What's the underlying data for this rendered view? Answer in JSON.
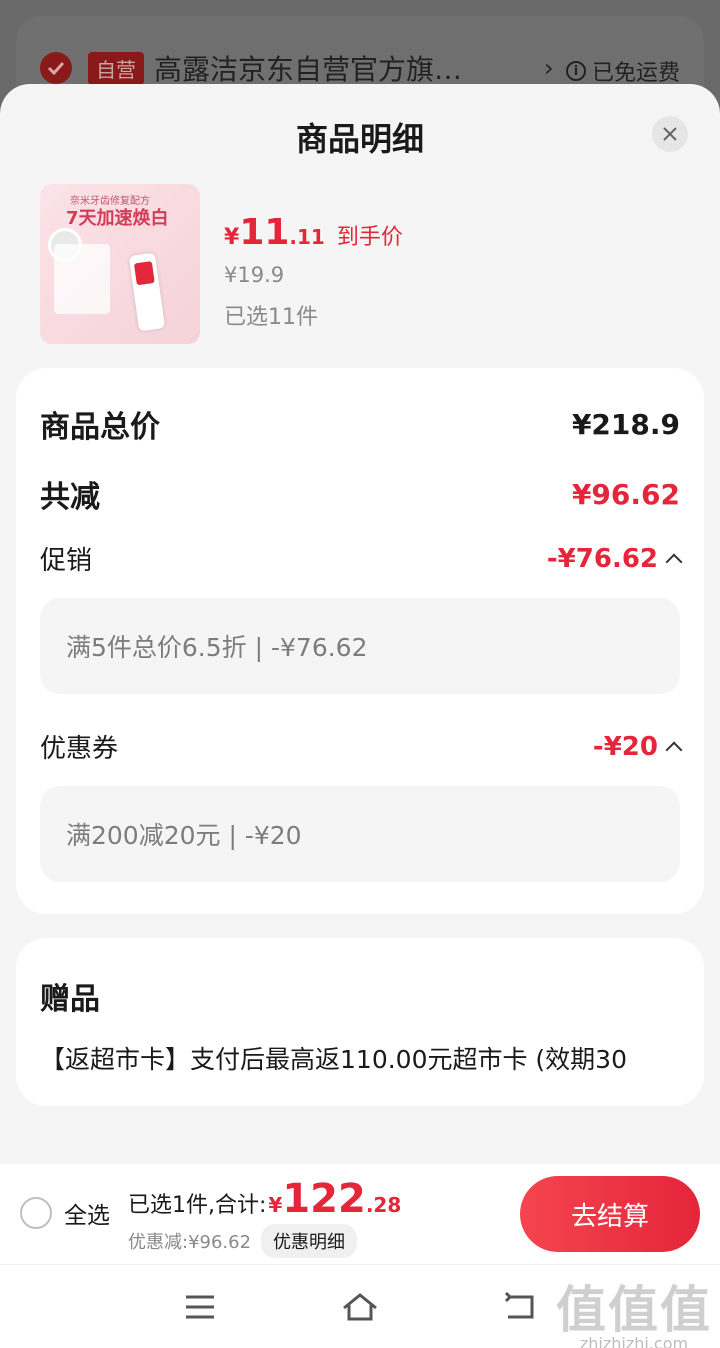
{
  "store_header": {
    "tag": "自营",
    "store_name": "高露洁京东自营官方旗…",
    "shipping": "已免运费"
  },
  "sheet": {
    "title": "商品明细"
  },
  "product": {
    "image_caption_small": "奈米牙齿修复配方",
    "image_caption_big": "7天加速焕白",
    "price_symbol": "¥",
    "price_int": "11",
    "price_dec": ".11",
    "price_tag": "到手价",
    "original_price": "¥19.9",
    "selected_qty": "已选11件"
  },
  "summary": {
    "total_label": "商品总价",
    "total_value": "¥218.9",
    "reduce_label": "共减",
    "reduce_value": "¥96.62",
    "promo_label": "促销",
    "promo_value": "-¥76.62",
    "promo_detail": "满5件总价6.5折 | -¥76.62",
    "coupon_label": "优惠券",
    "coupon_value": "-¥20",
    "coupon_detail": "满200减20元 | -¥20"
  },
  "gift": {
    "title": "赠品",
    "text": "【返超市卡】支付后最高返110.00元超市卡 (效期30"
  },
  "bottom_bar": {
    "select_all": "全选",
    "total_label": "已选1件,合计:",
    "total_symbol": "¥",
    "total_int": "122",
    "total_dec": ".28",
    "discount_text": "优惠减:¥96.62",
    "discount_detail_button": "优惠明细",
    "checkout_button": "去结算"
  },
  "watermark": {
    "big": "值值值",
    "small": "zhizhizhi.com"
  },
  "colors": {
    "accent_red": "#e4253a",
    "sheet_bg": "#f5f5f5",
    "overlay": "#5b5b5b"
  }
}
